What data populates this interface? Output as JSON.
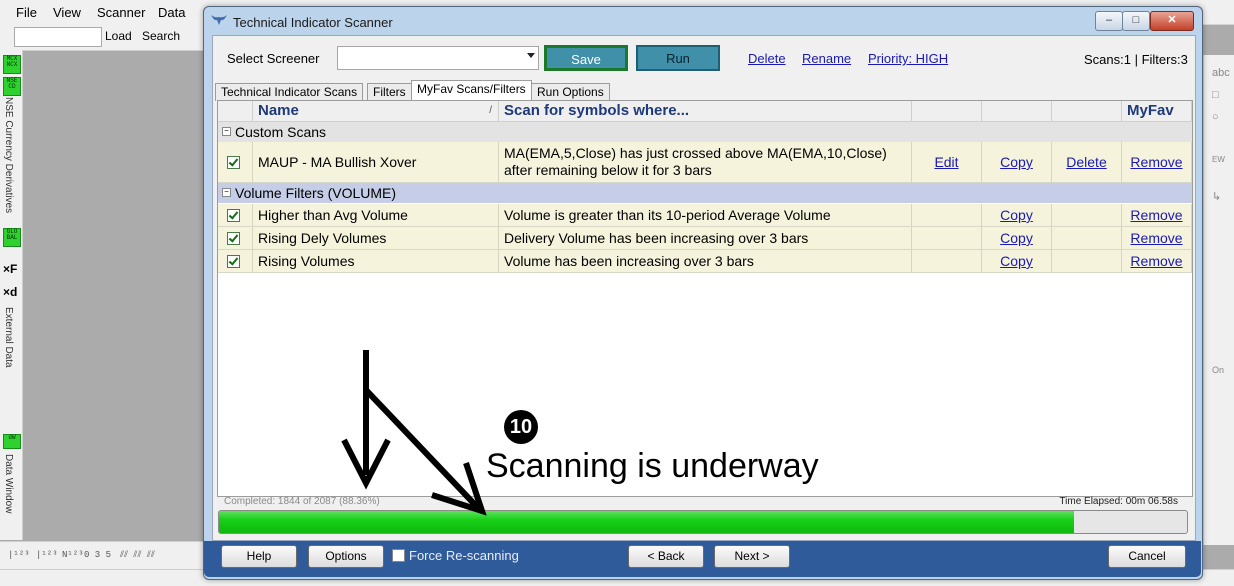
{
  "app": {
    "menu": [
      "File",
      "View",
      "Scanner",
      "Data"
    ],
    "toolbar": {
      "load": "Load",
      "search": "Search",
      "input_value": ""
    },
    "left_strip": {
      "tags": [
        "MCX NCX",
        "NSE CD",
        "GLO BAL",
        "dW"
      ],
      "vtexts": [
        "NSE Currency Derivatives",
        "External Data",
        "Data Window"
      ],
      "xf": "×F",
      "xd": "×d"
    },
    "right_strip": [
      "abc",
      "□",
      "○",
      "EW",
      "↳",
      "On"
    ]
  },
  "dialog": {
    "title": "Technical Indicator Scanner",
    "window_buttons": {
      "minimize": "–",
      "maximize": "□",
      "close": "✕"
    },
    "select_screener_label": "Select Screener",
    "screener_value": "",
    "save_label": "Save",
    "run_label": "Run",
    "links": {
      "delete": "Delete",
      "rename": "Rename",
      "priority": "Priority: HIGH"
    },
    "scan_counts": "Scans:1 | Filters:3",
    "tabs": [
      "Technical Indicator Scans",
      "Filters",
      "MyFav Scans/Filters",
      "Run Options"
    ],
    "active_tab": 2,
    "columns": {
      "name": "Name",
      "sort_mark": "/",
      "scan": "Scan for symbols where...",
      "myfav": "MyFav"
    },
    "groups": [
      {
        "title": "Custom Scans",
        "rows": [
          {
            "checked": true,
            "name": "MAUP - MA Bullish Xover",
            "desc": "MA(EMA,5,Close) has just crossed above MA(EMA,10,Close) after remaining below it for 3 bars",
            "edit": "Edit",
            "copy": "Copy",
            "delete": "Delete",
            "remove": "Remove"
          }
        ]
      },
      {
        "title": "Volume Filters (VOLUME)",
        "rows": [
          {
            "checked": true,
            "name": "Higher than Avg Volume",
            "desc": "Volume is greater than its 10-period Average Volume",
            "edit": "",
            "copy": "Copy",
            "delete": "",
            "remove": "Remove"
          },
          {
            "checked": true,
            "name": "Rising Dely Volumes",
            "desc": "Delivery Volume has been increasing over 3 bars",
            "edit": "",
            "copy": "Copy",
            "delete": "",
            "remove": "Remove"
          },
          {
            "checked": true,
            "name": "Rising Volumes",
            "desc": "Volume has been increasing over 3 bars",
            "edit": "",
            "copy": "Copy",
            "delete": "",
            "remove": "Remove"
          }
        ]
      }
    ],
    "annotation": {
      "number": "10",
      "text": "Scanning is underway"
    },
    "progress": {
      "label": "Completed: 1844 of 2087 (88.36%)",
      "elapsed": "Time Elapsed: 00m 06.58s",
      "fraction": 0.8836
    },
    "footer": {
      "help": "Help",
      "options": "Options",
      "force": "Force Re-scanning",
      "back": "< Back",
      "next": "Next >",
      "cancel": "Cancel"
    }
  }
}
